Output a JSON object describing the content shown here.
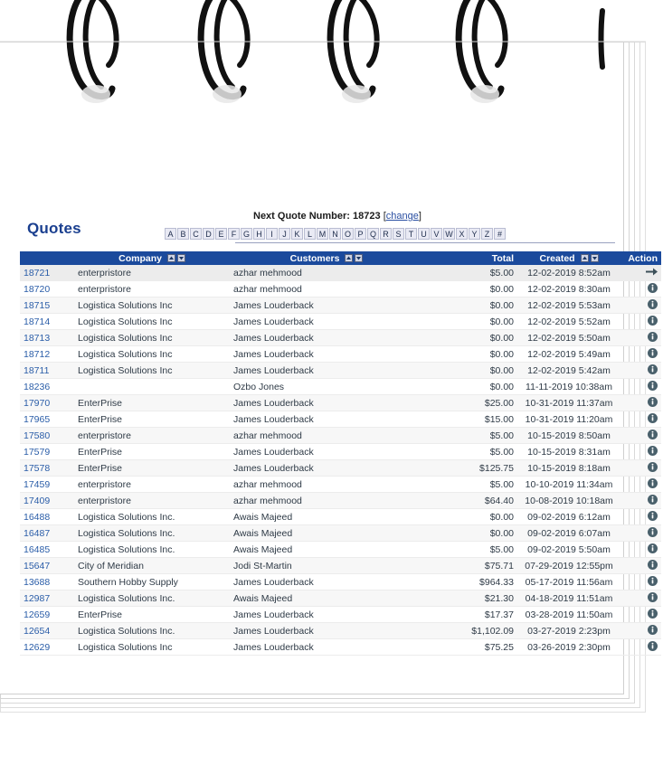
{
  "app": {
    "title": "Quotes",
    "theme": {
      "header_blue": "#1b4a9c",
      "title_blue": "#1a3f8f",
      "link_blue": "#2a5da8",
      "icon_dark": "#49606b",
      "alpha_bg": "#e9eaf4"
    }
  },
  "header": {
    "next_quote_label": "Next Quote Number:",
    "next_quote_number": "18723",
    "bracket_open": "[",
    "change_link": "change",
    "bracket_close": "]"
  },
  "alphabet_filter": {
    "letters": [
      "A",
      "B",
      "C",
      "D",
      "E",
      "F",
      "G",
      "H",
      "I",
      "J",
      "K",
      "L",
      "M",
      "N",
      "O",
      "P",
      "Q",
      "R",
      "S",
      "T",
      "U",
      "V",
      "W",
      "X",
      "Y",
      "Z",
      "#"
    ]
  },
  "table": {
    "columns": [
      {
        "key": "id",
        "label": "",
        "sortable": false
      },
      {
        "key": "company",
        "label": "Company",
        "sortable": true
      },
      {
        "key": "customer",
        "label": "Customers",
        "sortable": true
      },
      {
        "key": "total",
        "label": "Total",
        "sortable": false
      },
      {
        "key": "created",
        "label": "Created",
        "sortable": true
      },
      {
        "key": "action",
        "label": "Action",
        "sortable": false
      }
    ],
    "rows": [
      {
        "id": "18721",
        "company": "enterpristore",
        "customer": "azhar mehmood",
        "total": "$5.00",
        "created": "12-02-2019 8:52am",
        "action_icon": "arrow-right-icon",
        "highlighted": true
      },
      {
        "id": "18720",
        "company": "enterpristore",
        "customer": "azhar mehmood",
        "total": "$0.00",
        "created": "12-02-2019 8:30am",
        "action_icon": "info-icon"
      },
      {
        "id": "18715",
        "company": "Logistica Solutions Inc",
        "customer": "James Louderback",
        "total": "$0.00",
        "created": "12-02-2019 5:53am",
        "action_icon": "info-icon"
      },
      {
        "id": "18714",
        "company": "Logistica Solutions Inc",
        "customer": "James Louderback",
        "total": "$0.00",
        "created": "12-02-2019 5:52am",
        "action_icon": "info-icon"
      },
      {
        "id": "18713",
        "company": "Logistica Solutions Inc",
        "customer": "James Louderback",
        "total": "$0.00",
        "created": "12-02-2019 5:50am",
        "action_icon": "info-icon"
      },
      {
        "id": "18712",
        "company": "Logistica Solutions Inc",
        "customer": "James Louderback",
        "total": "$0.00",
        "created": "12-02-2019 5:49am",
        "action_icon": "info-icon"
      },
      {
        "id": "18711",
        "company": "Logistica Solutions Inc",
        "customer": "James Louderback",
        "total": "$0.00",
        "created": "12-02-2019 5:42am",
        "action_icon": "info-icon"
      },
      {
        "id": "18236",
        "company": "",
        "customer": "Ozbo Jones",
        "total": "$0.00",
        "created": "11-11-2019 10:38am",
        "action_icon": "info-icon"
      },
      {
        "id": "17970",
        "company": "EnterPrise",
        "customer": "James Louderback",
        "total": "$25.00",
        "created": "10-31-2019 11:37am",
        "action_icon": "info-icon"
      },
      {
        "id": "17965",
        "company": "EnterPrise",
        "customer": "James Louderback",
        "total": "$15.00",
        "created": "10-31-2019 11:20am",
        "action_icon": "info-icon"
      },
      {
        "id": "17580",
        "company": "enterpristore",
        "customer": "azhar mehmood",
        "total": "$5.00",
        "created": "10-15-2019 8:50am",
        "action_icon": "info-icon"
      },
      {
        "id": "17579",
        "company": "EnterPrise",
        "customer": "James Louderback",
        "total": "$5.00",
        "created": "10-15-2019 8:31am",
        "action_icon": "info-icon"
      },
      {
        "id": "17578",
        "company": "EnterPrise",
        "customer": "James Louderback",
        "total": "$125.75",
        "created": "10-15-2019 8:18am",
        "action_icon": "info-icon"
      },
      {
        "id": "17459",
        "company": "enterpristore",
        "customer": "azhar mehmood",
        "total": "$5.00",
        "created": "10-10-2019 11:34am",
        "action_icon": "info-icon"
      },
      {
        "id": "17409",
        "company": "enterpristore",
        "customer": "azhar mehmood",
        "total": "$64.40",
        "created": "10-08-2019 10:18am",
        "action_icon": "info-icon"
      },
      {
        "id": "16488",
        "company": "Logistica Solutions Inc.",
        "customer": "Awais Majeed",
        "total": "$0.00",
        "created": "09-02-2019 6:12am",
        "action_icon": "info-icon"
      },
      {
        "id": "16487",
        "company": "Logistica Solutions Inc.",
        "customer": "Awais Majeed",
        "total": "$0.00",
        "created": "09-02-2019 6:07am",
        "action_icon": "info-icon"
      },
      {
        "id": "16485",
        "company": "Logistica Solutions Inc.",
        "customer": "Awais Majeed",
        "total": "$5.00",
        "created": "09-02-2019 5:50am",
        "action_icon": "info-icon"
      },
      {
        "id": "15647",
        "company": "City of Meridian",
        "customer": "Jodi St-Martin",
        "total": "$75.71",
        "created": "07-29-2019 12:55pm",
        "action_icon": "info-icon"
      },
      {
        "id": "13688",
        "company": "Southern Hobby Supply",
        "customer": "James Louderback",
        "total": "$964.33",
        "created": "05-17-2019 11:56am",
        "action_icon": "info-icon"
      },
      {
        "id": "12987",
        "company": "Logistica Solutions Inc.",
        "customer": "Awais Majeed",
        "total": "$21.30",
        "created": "04-18-2019 11:51am",
        "action_icon": "info-icon"
      },
      {
        "id": "12659",
        "company": "EnterPrise",
        "customer": "James Louderback",
        "total": "$17.37",
        "created": "03-28-2019 11:50am",
        "action_icon": "info-icon"
      },
      {
        "id": "12654",
        "company": "Logistica Solutions Inc.",
        "customer": "James Louderback",
        "total": "$1,102.09",
        "created": "03-27-2019 2:23pm",
        "action_icon": "info-icon"
      },
      {
        "id": "12629",
        "company": "Logistica Solutions Inc",
        "customer": "James Louderback",
        "total": "$75.25",
        "created": "03-26-2019 2:30pm",
        "action_icon": "info-icon"
      }
    ]
  },
  "decoration": {
    "spiral_ring_count": 4,
    "partial_ring": true
  }
}
